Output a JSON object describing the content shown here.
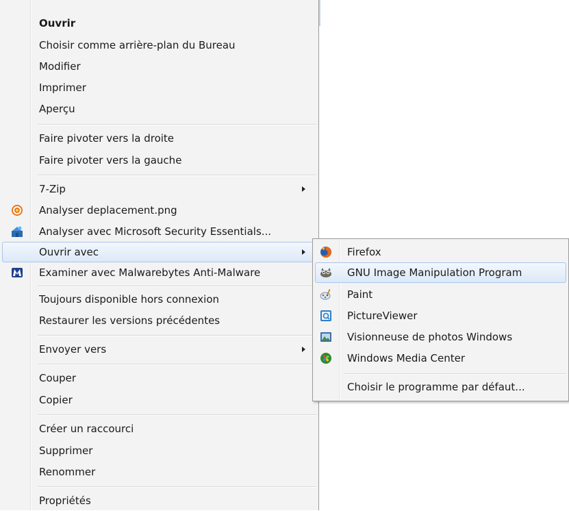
{
  "context_menu": {
    "items": [
      {
        "label": "Ouvrir"
      },
      {
        "label": "Choisir comme arrière-plan du Bureau"
      },
      {
        "label": "Modifier"
      },
      {
        "label": "Imprimer"
      },
      {
        "label": "Aperçu"
      },
      {
        "label": "Faire pivoter vers la droite"
      },
      {
        "label": "Faire pivoter vers la gauche"
      },
      {
        "label": "7-Zip"
      },
      {
        "label": "Analyser deplacement.png"
      },
      {
        "label": "Analyser avec Microsoft Security Essentials..."
      },
      {
        "label": "Ouvrir avec"
      },
      {
        "label": "Examiner avec Malwarebytes Anti-Malware"
      },
      {
        "label": "Toujours disponible hors connexion"
      },
      {
        "label": "Restaurer les versions précédentes"
      },
      {
        "label": "Envoyer vers"
      },
      {
        "label": "Couper"
      },
      {
        "label": "Copier"
      },
      {
        "label": "Créer un raccourci"
      },
      {
        "label": "Supprimer"
      },
      {
        "label": "Renommer"
      },
      {
        "label": "Propriétés"
      }
    ]
  },
  "open_with_submenu": {
    "items": [
      {
        "label": "Firefox",
        "icon": "firefox-icon"
      },
      {
        "label": "GNU Image Manipulation Program",
        "icon": "gimp-icon"
      },
      {
        "label": "Paint",
        "icon": "paint-icon"
      },
      {
        "label": "PictureViewer",
        "icon": "pictureviewer-icon"
      },
      {
        "label": "Visionneuse de photos Windows",
        "icon": "photo-viewer-icon"
      },
      {
        "label": "Windows Media Center",
        "icon": "media-center-icon"
      },
      {
        "label": "Choisir le programme par défaut..."
      }
    ]
  },
  "colors": {
    "menu_background": "#f3f3f3",
    "highlight_border": "#a9c5ea",
    "highlight_fill": "#dde9f8"
  }
}
